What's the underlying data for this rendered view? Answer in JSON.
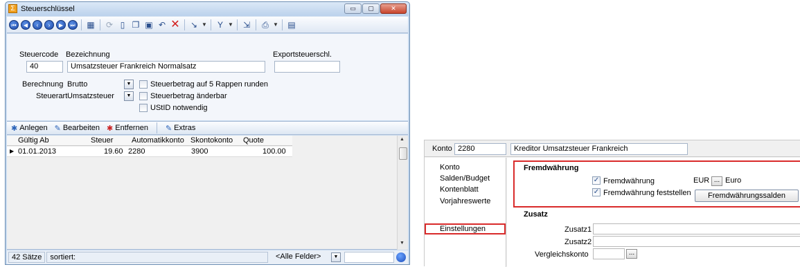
{
  "window1": {
    "title": "Steuerschlüssel",
    "minimize_label": "▭",
    "maximize_label": "▢",
    "close_label": "✕",
    "form": {
      "steuercode_label": "Steuercode",
      "steuercode_value": "40",
      "bezeichnung_label": "Bezeichnung",
      "bezeichnung_value": "Umsatzsteuer Frankreich Normalsatz",
      "export_label": "Exportsteuerschl.",
      "export_value": "",
      "berechnung_label": "Berechnung",
      "berechnung_value": "Brutto",
      "steuerart_label": "Steuerart",
      "steuerart_value": "Umsatzsteuer",
      "chk_rappen_label": "Steuerbetrag auf 5 Rappen runden",
      "chk_aenderbar_label": "Steuerbetrag änderbar",
      "chk_ustid_label": "UStID notwendig"
    },
    "subtoolbar": {
      "anlegen": "Anlegen",
      "bearbeiten": "Bearbeiten",
      "entfernen": "Entfernen",
      "extras": "Extras"
    },
    "grid": {
      "headers": [
        "Gültig Ab",
        "Steuer",
        "Automatikkonto",
        "Skontokonto",
        "Quote"
      ],
      "rows": [
        [
          "01.01.2013",
          "19.60",
          "2280",
          "3900",
          "100.00"
        ]
      ]
    },
    "status": {
      "count": "42 Sätze",
      "sorted": "sortiert:",
      "filter": "<Alle Felder>"
    }
  },
  "window2": {
    "konto_label": "Konto",
    "konto_value": "2280",
    "konto_name": "Kreditor Umsatzsteuer Frankreich",
    "nav": [
      "Konto",
      "Salden/Budget",
      "Kontenblatt",
      "Vorjahreswerte",
      "Einstellungen"
    ],
    "fremd": {
      "title": "Fremdwährung",
      "chk_fremd_label": "Fremdwährung",
      "chk_feststellen_label": "Fremdwährung feststellen",
      "currency_code": "EUR",
      "ellipsis": "...",
      "currency_name": "Euro",
      "saldo_button": "Fremdwährungssalden"
    },
    "zusatz": {
      "title": "Zusatz",
      "zusatz1_label": "Zusatz1",
      "zusatz2_label": "Zusatz2",
      "vergleich_label": "Vergleichskonto",
      "ellipsis": "..."
    }
  },
  "colors": {
    "highlight": "#d92a2a",
    "toolbar_blue": "#1b47a8"
  }
}
